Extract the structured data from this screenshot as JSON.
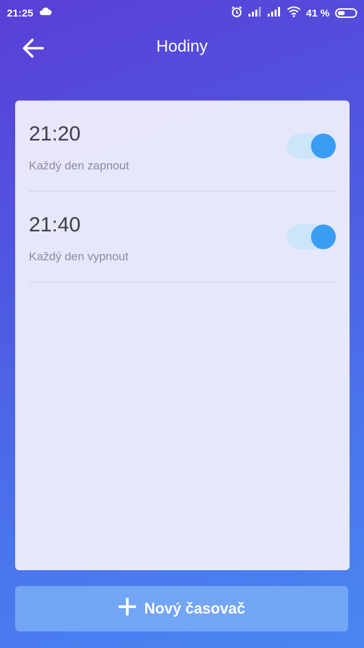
{
  "status_bar": {
    "time": "21:25",
    "battery": "41 %",
    "battery_level": 0.41,
    "icons": [
      "cloud-icon",
      "alarm-icon",
      "signal-icon",
      "signal-icon",
      "wifi-icon",
      "battery-icon"
    ]
  },
  "header": {
    "title": "Hodiny",
    "back_icon": "arrow-left-icon"
  },
  "timers": [
    {
      "time": "21:20",
      "description": "Každý den zapnout",
      "enabled": true
    },
    {
      "time": "21:40",
      "description": "Každý den vypnout",
      "enabled": true
    }
  ],
  "new_timer": {
    "label": "Nový časovač",
    "icon": "plus-icon"
  },
  "colors": {
    "toggle_on": "#3a9cf2",
    "toggle_track": "#cbe5fb"
  }
}
